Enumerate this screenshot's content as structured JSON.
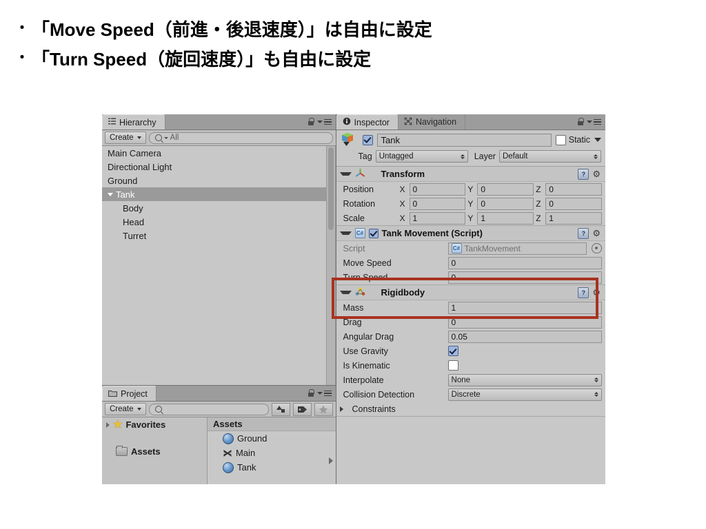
{
  "slide": {
    "bullet_mark": "・",
    "bullets": [
      "「Move Speed（前進・後退速度）」は自由に設定",
      "「Turn Speed（旋回速度）」も自由に設定"
    ]
  },
  "hierarchy": {
    "tab_label": "Hierarchy",
    "create_label": "Create",
    "search_value": "All",
    "items": [
      {
        "label": "Main Camera",
        "indent": 0,
        "selected": false,
        "expandable": false
      },
      {
        "label": "Directional Light",
        "indent": 0,
        "selected": false,
        "expandable": false
      },
      {
        "label": "Ground",
        "indent": 0,
        "selected": false,
        "expandable": false
      },
      {
        "label": "Tank",
        "indent": 0,
        "selected": true,
        "expandable": true
      },
      {
        "label": "Body",
        "indent": 1,
        "selected": false,
        "expandable": false
      },
      {
        "label": "Head",
        "indent": 1,
        "selected": false,
        "expandable": false
      },
      {
        "label": "Turret",
        "indent": 1,
        "selected": false,
        "expandable": false
      }
    ]
  },
  "project": {
    "tab_label": "Project",
    "create_label": "Create",
    "search_placeholder": "",
    "tree": [
      {
        "label": "Favorites"
      },
      {
        "label": "Assets"
      }
    ],
    "column_header": "Assets",
    "assets": [
      {
        "label": "Ground",
        "icon": "material-sphere-icon"
      },
      {
        "label": "Main",
        "icon": "unity-scene-icon"
      },
      {
        "label": "Tank",
        "icon": "material-sphere-icon"
      }
    ]
  },
  "inspector": {
    "tabs": [
      {
        "label": "Inspector",
        "active": true,
        "icon": "info-icon"
      },
      {
        "label": "Navigation",
        "active": false,
        "icon": "navigation-icon"
      }
    ],
    "object": {
      "name": "Tank",
      "enabled": true,
      "static_label": "Static",
      "static_checked": false,
      "tag_label": "Tag",
      "tag_value": "Untagged",
      "layer_label": "Layer",
      "layer_value": "Default"
    },
    "components": [
      {
        "title": "Transform",
        "icon": "transform-gizmo-icon",
        "has_checkbox": false,
        "rows": [
          {
            "type": "vector3",
            "label": "Position",
            "x": "0",
            "y": "0",
            "z": "0"
          },
          {
            "type": "vector3",
            "label": "Rotation",
            "x": "0",
            "y": "0",
            "z": "0"
          },
          {
            "type": "vector3",
            "label": "Scale",
            "x": "1",
            "y": "1",
            "z": "1"
          }
        ]
      },
      {
        "title": "Tank Movement (Script)",
        "icon": "csharp-script-icon",
        "has_checkbox": true,
        "checked": true,
        "rows": [
          {
            "type": "object",
            "label": "Script",
            "value": "TankMovement",
            "dim": true
          },
          {
            "type": "text",
            "label": "Move Speed",
            "value": "0",
            "highlighted": true
          },
          {
            "type": "text",
            "label": "Turn Speed",
            "value": "0",
            "highlighted": true
          }
        ]
      },
      {
        "title": "Rigidbody",
        "icon": "rigidbody-icon",
        "has_checkbox": false,
        "rows": [
          {
            "type": "text",
            "label": "Mass",
            "value": "1"
          },
          {
            "type": "text",
            "label": "Drag",
            "value": "0"
          },
          {
            "type": "text",
            "label": "Angular Drag",
            "value": "0.05"
          },
          {
            "type": "checkbox",
            "label": "Use Gravity",
            "checked": true
          },
          {
            "type": "checkbox",
            "label": "Is Kinematic",
            "checked": false
          },
          {
            "type": "dropdown",
            "label": "Interpolate",
            "value": "None"
          },
          {
            "type": "dropdown",
            "label": "Collision Detection",
            "value": "Discrete"
          },
          {
            "type": "foldout",
            "label": "Constraints"
          }
        ]
      }
    ]
  },
  "colors": {
    "highlight_box": "#a83220",
    "panel_bg": "#c8c8c8",
    "selection": "#9a9a9a",
    "checkbox_accent": "#9fb6dd"
  }
}
